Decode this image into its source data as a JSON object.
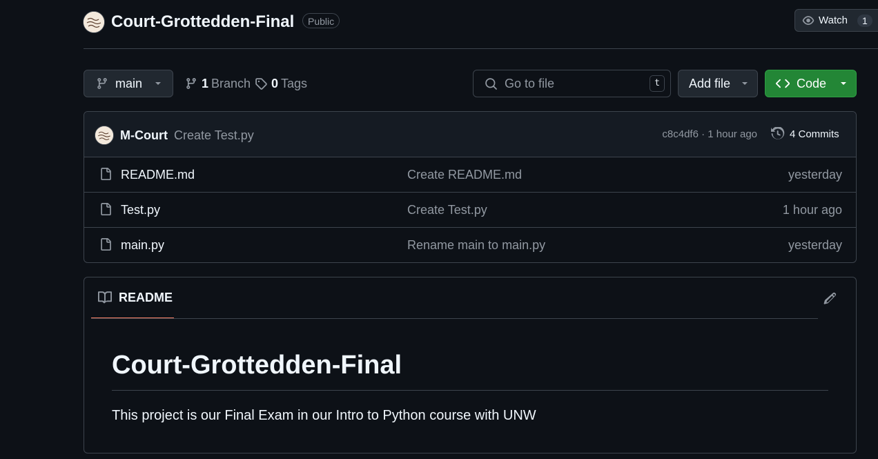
{
  "repo": {
    "name": "Court-Grottedden-Final",
    "visibility": "Public",
    "watch_label": "Watch",
    "watch_count": "1"
  },
  "toolbar": {
    "branch": "main",
    "branch_count": "1",
    "branch_label": "Branch",
    "tags_count": "0",
    "tags_label": "Tags",
    "search_placeholder": "Go to file",
    "search_shortcut": "t",
    "add_file_label": "Add file",
    "code_label": "Code"
  },
  "latest_commit": {
    "author": "M-Court",
    "message": "Create Test.py",
    "meta": "c8c4df6 · 1 hour ago",
    "commits_label": "4 Commits"
  },
  "files": [
    {
      "name": "README.md",
      "commit": "Create README.md",
      "time": "yesterday"
    },
    {
      "name": "Test.py",
      "commit": "Create Test.py",
      "time": "1 hour ago"
    },
    {
      "name": "main.py",
      "commit": "Rename main to main.py",
      "time": "yesterday"
    }
  ],
  "readme": {
    "tab_label": "README",
    "heading": "Court-Grottedden-Final",
    "paragraph": "This project is our Final Exam in our Intro to Python course with UNW"
  },
  "colors": {
    "background": "#0d1117",
    "border": "#3d444d",
    "code_button": "#238636",
    "readme_tab_underline": "#f78166"
  },
  "icons": {
    "watch": "eye-icon",
    "branch": "git-branch-icon",
    "tags": "tag-icon",
    "search": "search-icon",
    "code": "code-icon",
    "commits": "history-icon",
    "file": "file-icon",
    "readme": "book-icon",
    "edit": "pencil-icon"
  }
}
